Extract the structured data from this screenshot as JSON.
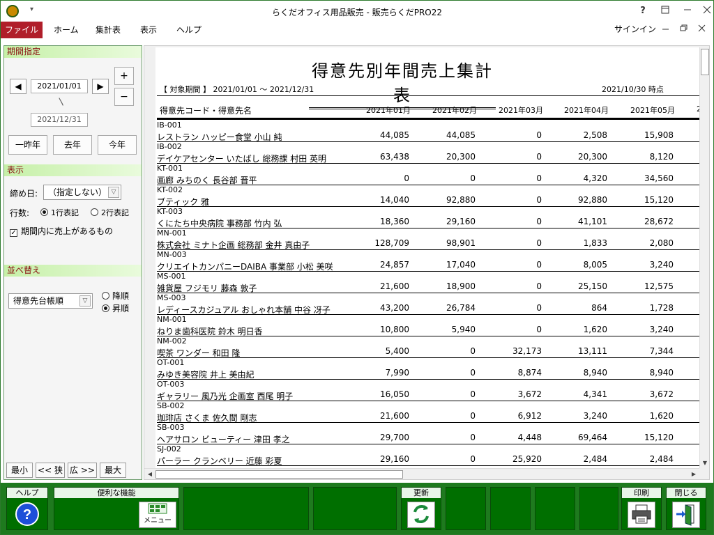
{
  "window": {
    "title": "らくだオフィス用品販売 - 販売らくだPRO22",
    "help": "?",
    "quick_access": "▾"
  },
  "menu": {
    "items": [
      "ファイル",
      "ホーム",
      "集計表",
      "表示",
      "ヘルプ"
    ],
    "signin": "サインイン"
  },
  "left": {
    "period_header": "期間指定",
    "date_from": "2021/01/01",
    "date_to": "2021/12/31",
    "tilde": "〵",
    "plus": "+",
    "minus": "−",
    "prev": "◀",
    "next": "▶",
    "btn_two_years_ago": "一昨年",
    "btn_last_year": "去年",
    "btn_this_year": "今年",
    "display_header": "表示",
    "closing_label": "締め日:",
    "closing_value": "（指定しない）",
    "rows_label": "行数:",
    "rows_one": "1行表記",
    "rows_two": "2行表記",
    "rows_selected": "1行表記",
    "only_sales_label": "期間内に売上があるもの",
    "only_sales_checked": true,
    "sort_header": "並べ替え",
    "sort_value": "得意先台帳順",
    "desc": "降順",
    "asc": "昇順",
    "sort_selected": "昇順",
    "zoom": [
      "最小",
      "<< 狭",
      "広 >>",
      "最大"
    ]
  },
  "report": {
    "title": "得意先別年間売上集計表",
    "period": "【 対象期間 】 2021/01/01 ～ 2021/12/31",
    "as_of": "2021/10/30 時点",
    "col_customer": "得意先コード・得意先名",
    "months": [
      "2021年01月",
      "2021年02月",
      "2021年03月",
      "2021年04月",
      "2021年05月",
      "2"
    ],
    "rows": [
      {
        "code": "IB-001",
        "name": "レストラン ハッピー食堂 小山 純",
        "v": [
          "44,085",
          "44,085",
          "0",
          "2,508",
          "15,908"
        ]
      },
      {
        "code": "IB-002",
        "name": "デイケアセンター いたばし 総務課 村田 英明",
        "v": [
          "63,438",
          "20,300",
          "0",
          "20,300",
          "8,120"
        ]
      },
      {
        "code": "KT-001",
        "name": "画廊 みちのく 長谷部 晋平",
        "v": [
          "0",
          "0",
          "0",
          "4,320",
          "34,560"
        ]
      },
      {
        "code": "KT-002",
        "name": "ブティック 雅",
        "v": [
          "14,040",
          "92,880",
          "0",
          "92,880",
          "15,120"
        ]
      },
      {
        "code": "KT-003",
        "name": "くにたち中央病院 事務部 竹内 弘",
        "v": [
          "18,360",
          "29,160",
          "0",
          "41,101",
          "28,672"
        ]
      },
      {
        "code": "MN-001",
        "name": "株式会社 ミナト企画 総務部 金井 真由子",
        "v": [
          "128,709",
          "98,901",
          "0",
          "1,833",
          "2,080"
        ]
      },
      {
        "code": "MN-003",
        "name": "クリエイトカンパニーDAIBA 事業部 小松 美咲",
        "v": [
          "24,857",
          "17,040",
          "0",
          "8,005",
          "3,240"
        ]
      },
      {
        "code": "MS-001",
        "name": "雑貨屋 フジモリ 藤森 敦子",
        "v": [
          "21,600",
          "18,900",
          "0",
          "25,150",
          "12,575"
        ]
      },
      {
        "code": "MS-003",
        "name": "レディースカジュアル おしゃれ本舗 中谷 冴子",
        "v": [
          "43,200",
          "26,784",
          "0",
          "864",
          "1,728"
        ]
      },
      {
        "code": "NM-001",
        "name": "ねりま歯科医院 鈴木 明日香",
        "v": [
          "10,800",
          "5,940",
          "0",
          "1,620",
          "3,240"
        ]
      },
      {
        "code": "NM-002",
        "name": "喫茶 ワンダー 和田 隆",
        "v": [
          "5,400",
          "0",
          "32,173",
          "13,111",
          "7,344"
        ]
      },
      {
        "code": "OT-001",
        "name": "みゆき美容院 井上 美由紀",
        "v": [
          "7,990",
          "0",
          "8,874",
          "8,940",
          "8,940"
        ]
      },
      {
        "code": "OT-003",
        "name": "ギャラリー 風乃光 企画室 西尾 明子",
        "v": [
          "16,050",
          "0",
          "3,672",
          "4,341",
          "3,672"
        ]
      },
      {
        "code": "SB-002",
        "name": "珈琲店 さくま 佐久間 剛志",
        "v": [
          "21,600",
          "0",
          "6,912",
          "3,240",
          "1,620"
        ]
      },
      {
        "code": "SB-003",
        "name": "ヘアサロン ビューティー 津田 孝之",
        "v": [
          "29,700",
          "0",
          "4,448",
          "69,464",
          "15,120"
        ]
      },
      {
        "code": "SJ-002",
        "name": "パーラー クランベリー 近藤 彩夏",
        "v": [
          "29,160",
          "0",
          "25,920",
          "2,484",
          "2,484"
        ]
      }
    ]
  },
  "footer": {
    "help": "ヘルプ",
    "tools": "便利な機能",
    "menu_icon_label": "メニュー",
    "refresh": "更新",
    "print": "印刷",
    "close": "閉じる"
  },
  "colors": {
    "accent_red": "#b01e2a",
    "footer_green": "#1e7a1e",
    "section_green": "#c6f0a8"
  }
}
